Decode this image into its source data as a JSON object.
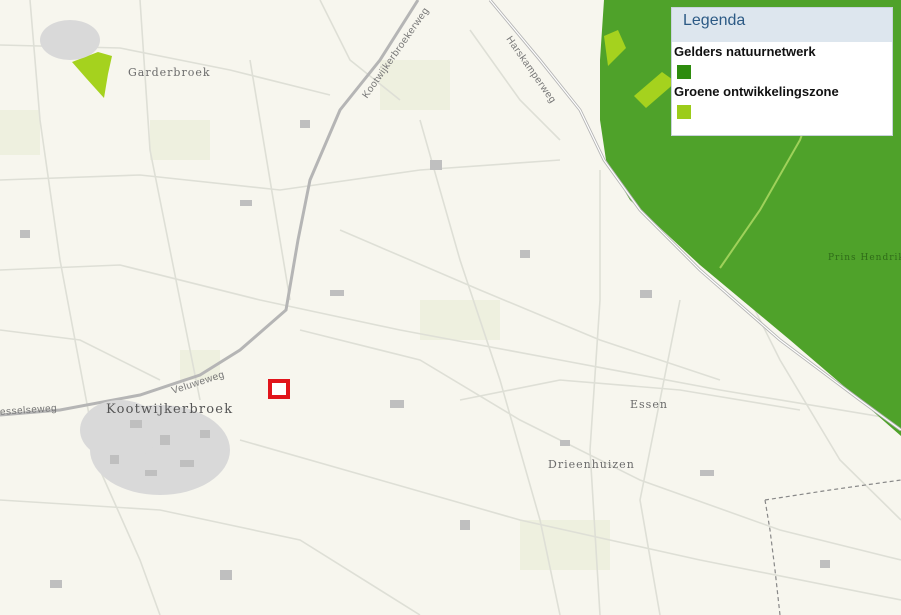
{
  "map": {
    "places": {
      "garderbroek": "Garderbroek",
      "kootwijkerbroek": "Kootwijkerbroek",
      "essen": "Essen",
      "drieenhuizen": "Drieenhuizen",
      "prins_hendrik": "Prins Hendrik"
    },
    "roads": {
      "kootwijkerbroekerweg": "Kootwijkerbroekerweg",
      "harskamperweg": "Harskamperweg",
      "veluweweg": "Veluweweg",
      "esselseweg": "esselseweg"
    },
    "colors": {
      "background": "#f7f6ee",
      "gelders_natuurnetwerk": "#4fa22a",
      "groene_ontwikkelingszone": "#a5d21e",
      "marker": "#e1141b"
    }
  },
  "legend": {
    "title": "Legenda",
    "items": [
      {
        "label": "Gelders natuurnetwerk",
        "color": "#2e8c0e"
      },
      {
        "label": "Groene ontwikkelingszone",
        "color": "#9ccc1a"
      }
    ]
  }
}
